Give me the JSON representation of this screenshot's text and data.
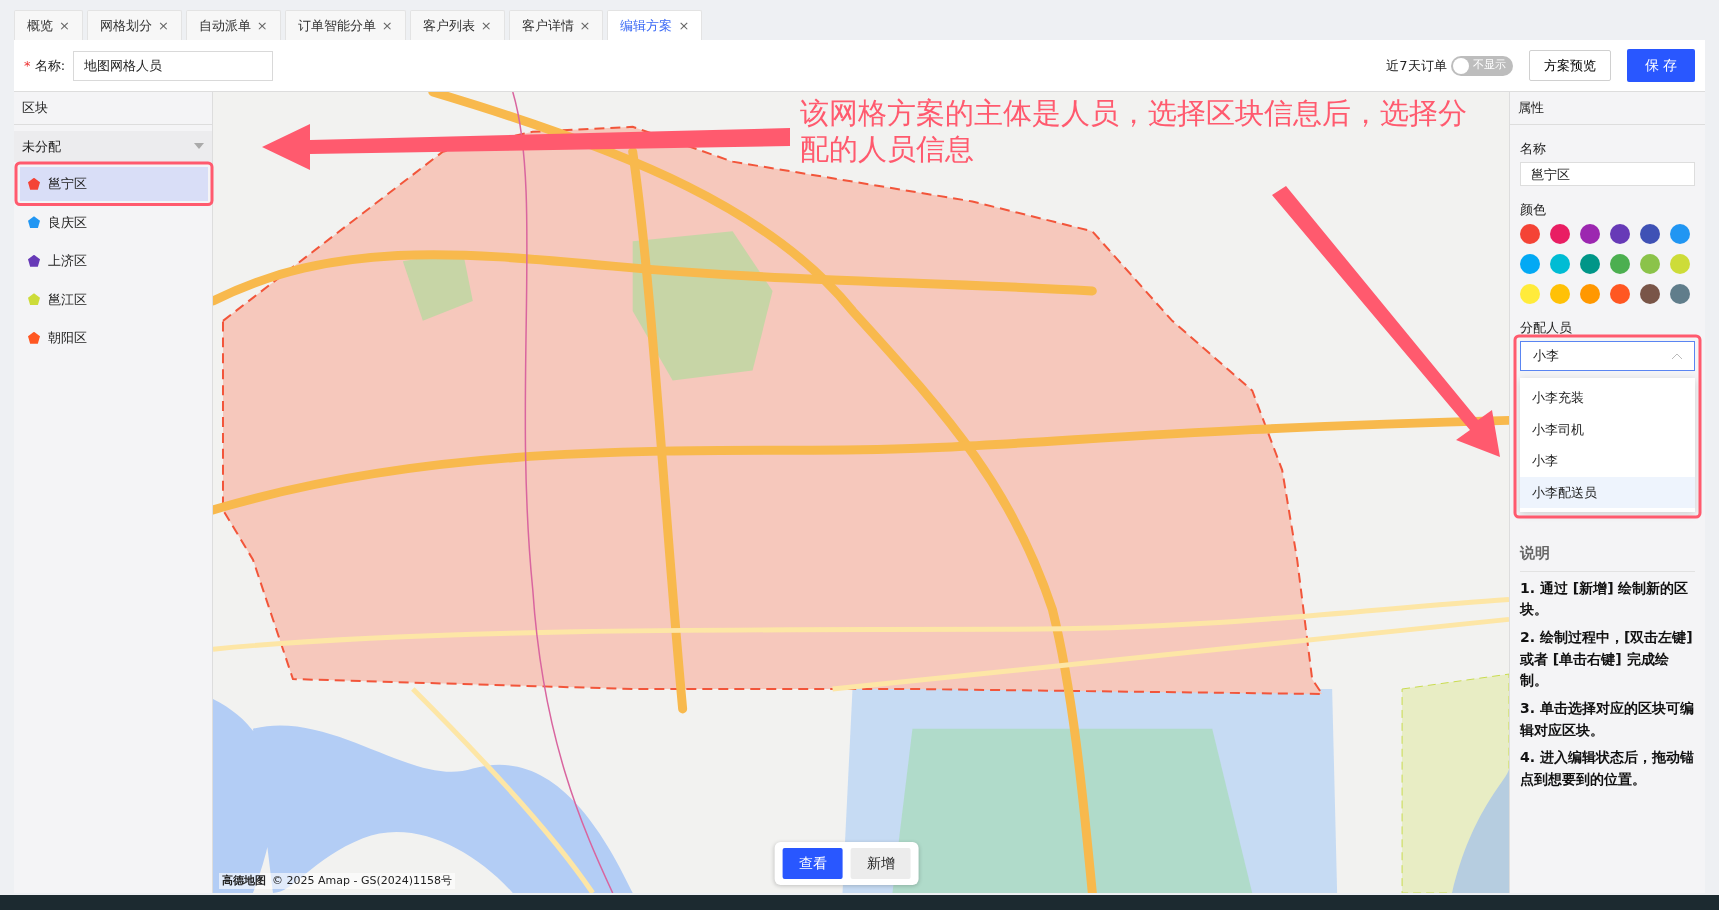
{
  "tabs": [
    {
      "label": "概览",
      "selected": false,
      "close": "×"
    },
    {
      "label": "网格划分",
      "selected": false,
      "close": "×"
    },
    {
      "label": "自动派单",
      "selected": false,
      "close": "×"
    },
    {
      "label": "订单智能分单",
      "selected": false,
      "close": "×"
    },
    {
      "label": "客户列表",
      "selected": false,
      "close": "×"
    },
    {
      "label": "客户详情",
      "selected": false,
      "close": "×"
    },
    {
      "label": "编辑方案",
      "selected": true,
      "close": "×"
    }
  ],
  "header": {
    "required_mark": "*",
    "name_label": "名称:",
    "name_value": "地图网格人员",
    "orders_label": "近7天订单",
    "orders_toggle": {
      "on": false,
      "text": "不显示"
    },
    "preview_button": "方案预览",
    "save_button": "保 存"
  },
  "blocks_panel": {
    "title": "区块",
    "group": "未分配",
    "items": [
      {
        "name": "邕宁区",
        "color": "#f44336",
        "selected": true
      },
      {
        "name": "良庆区",
        "color": "#2196f3",
        "selected": false
      },
      {
        "name": "上济区",
        "color": "#673ab7",
        "selected": false
      },
      {
        "name": "邕江区",
        "color": "#cddc39",
        "selected": false
      },
      {
        "name": "朝阳区",
        "color": "#ff5722",
        "selected": false
      }
    ]
  },
  "map": {
    "attribution_logo": "高德地图",
    "attribution": "© 2025 Amap - GS(2024)1158号",
    "buttons": [
      {
        "label": "查看",
        "selected": true
      },
      {
        "label": "新增",
        "selected": false
      }
    ]
  },
  "annotation": {
    "text": "该网格方案的主体是人员，选择区块信息后，选择分配的人员信息"
  },
  "properties": {
    "title": "属性",
    "name_label": "名称",
    "name_value": "邕宁区",
    "color_label": "颜色",
    "colors": [
      {
        "color": "#f44336"
      },
      {
        "color": "#e91e63"
      },
      {
        "color": "#9c27b0"
      },
      {
        "color": "#673ab7"
      },
      {
        "color": "#3f51b5"
      },
      {
        "color": "#2196f3"
      },
      {
        "color": "#03a9f4"
      },
      {
        "color": "#00bcd4"
      },
      {
        "color": "#009688"
      },
      {
        "color": "#4caf50"
      },
      {
        "color": "#8bc34a"
      },
      {
        "color": "#cddc39"
      },
      {
        "color": "#ffeb3b"
      },
      {
        "color": "#ffc107"
      },
      {
        "color": "#ff9800"
      },
      {
        "color": "#ff5722"
      },
      {
        "color": "#795548"
      },
      {
        "color": "#607d8b"
      }
    ],
    "assign_label": "分配人员",
    "assign_value": "小李",
    "options": [
      {
        "label": "小李充装",
        "selected": false
      },
      {
        "label": "小李司机",
        "selected": false
      },
      {
        "label": "小李",
        "selected": false
      },
      {
        "label": "小李配送员",
        "selected": true
      }
    ]
  },
  "help": {
    "title": "说明",
    "items": [
      "1. 通过 [新增] 绘制新的区块。",
      "2. 绘制过程中，[双击左键] 或者 [单击右键] 完成绘制。",
      "3. 单击选择对应的区块可编辑对应区块。",
      "4. 进入编辑状态后，拖动锚点到想要到的位置。"
    ]
  }
}
